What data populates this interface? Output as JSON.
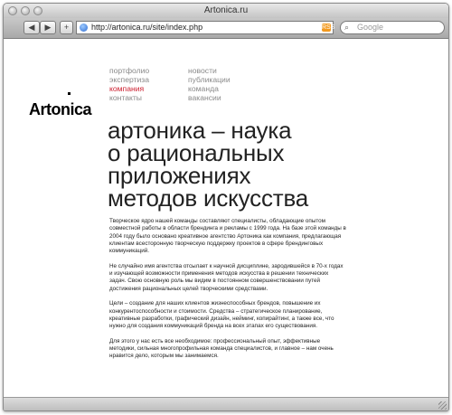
{
  "window": {
    "title": "Artonica.ru"
  },
  "toolbar": {
    "back_label": "◀",
    "forward_label": "▶",
    "add_label": "+",
    "url": "http://artonica.ru/site/index.php",
    "rss_label": "RSS",
    "search_placeholder": "Google"
  },
  "nav": {
    "left": [
      {
        "label": "портфолио",
        "active": false
      },
      {
        "label": "экспертиза",
        "active": false
      },
      {
        "label": "компания",
        "active": true
      },
      {
        "label": "контакты",
        "active": false
      }
    ],
    "right": [
      {
        "label": "новости"
      },
      {
        "label": "публикации"
      },
      {
        "label": "команда"
      },
      {
        "label": "вакансии"
      }
    ]
  },
  "logo": "Artonica",
  "headline": {
    "lines": [
      "артоника – наука",
      "о рациональных",
      "приложениях",
      "методов искусства"
    ]
  },
  "paragraphs": [
    "Творческое ядро нашей команды составляют специалисты, обладающие опытом совместной работы в области брендинга и рекламы с 1999 года. На базе этой команды в 2004 году было основано креативное агентство Артоника как компания, предлагающая клиентам всесторонную творческую поддержку проектов в сфере брендинговых коммуникаций.",
    "Не случайно имя агентства отсылает к научной дисциплине, зародившейся в 70-х годах и изучающей возможности применения методов искусства в решении технических задач. Свою основную роль мы видим в постоянном совершенствовании путей достижения рациональных целей творческими средствами.",
    "Цели – создание для наших клиентов жизнеспособных брендов, повышение их конкурентоспособности и стоимости. Средства – стратегическое планирование, креативные разработки, графический дизайн, нейминг, копирайтинг, а также все, что нужно для создания коммуникаций бренда на всех этапах его существования.",
    "Для этого у нас есть все необходимое: профессиональный опыт, эффективные методики, сильная многопрофильная команда специалистов, и главное – нам очень нравится дело, которым мы занимаемся."
  ],
  "colors": {
    "accent": "#cc1f2f",
    "nav_text": "#8a8a8a"
  }
}
